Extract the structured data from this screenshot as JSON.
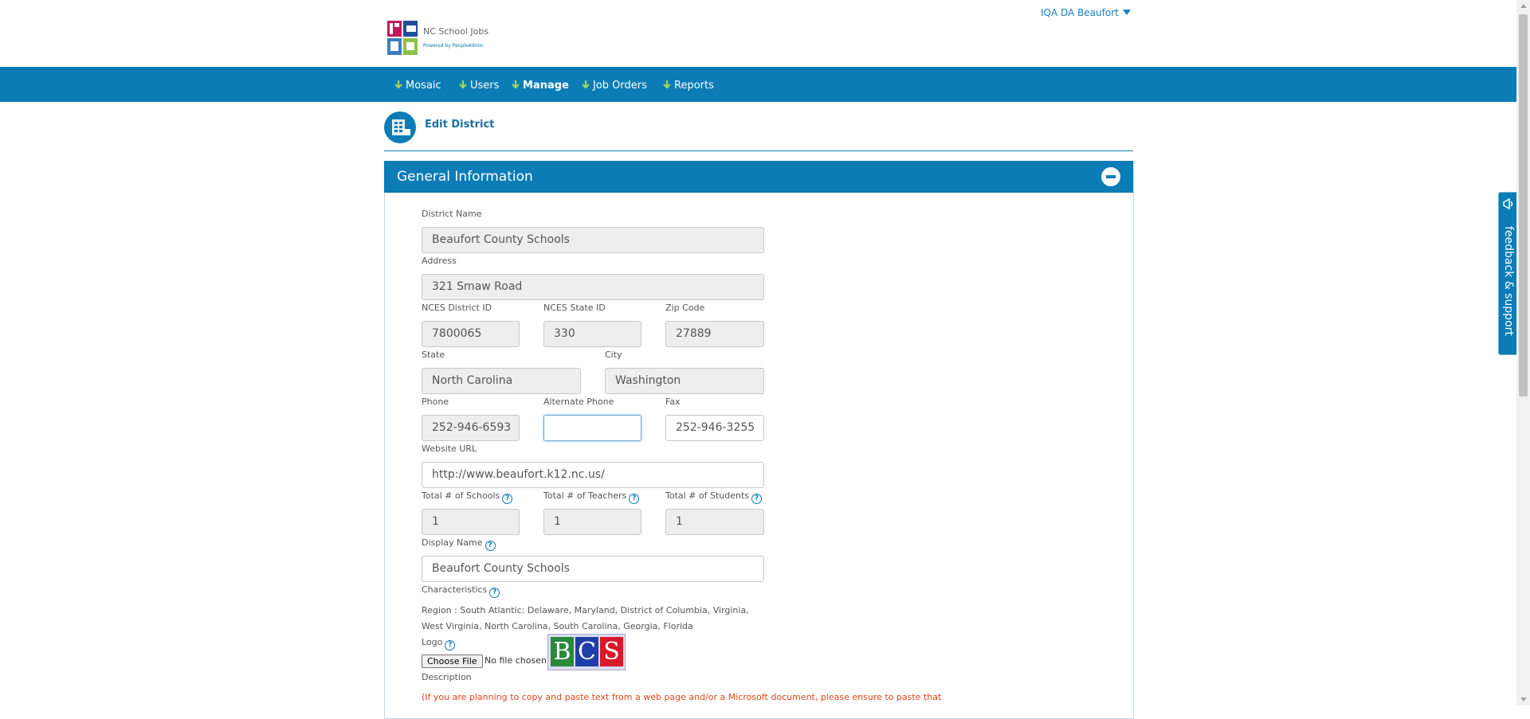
{
  "header": {
    "logo_title": "NC School Jobs",
    "logo_sub": "Powered by PeopleAdmin",
    "user_menu": "IQA DA Beaufort"
  },
  "nav": [
    {
      "label": "Mosaic",
      "bold": false
    },
    {
      "label": "Users",
      "bold": false
    },
    {
      "label": "Manage",
      "bold": true
    },
    {
      "label": "Job Orders",
      "bold": false
    },
    {
      "label": "Reports",
      "bold": false
    }
  ],
  "page": {
    "title": "Edit District"
  },
  "panel": {
    "title": "General Information"
  },
  "form": {
    "district_name": {
      "label": "District Name",
      "value": "Beaufort County Schools"
    },
    "address": {
      "label": "Address",
      "value": "321 Smaw Road"
    },
    "nces_district_id": {
      "label": "NCES District ID",
      "value": "7800065"
    },
    "nces_state_id": {
      "label": "NCES State ID",
      "value": "330"
    },
    "zip": {
      "label": "Zip Code",
      "value": "27889"
    },
    "state": {
      "label": "State",
      "value": "North Carolina"
    },
    "city": {
      "label": "City",
      "value": "Washington"
    },
    "phone": {
      "label": "Phone",
      "value": "252-946-6593"
    },
    "alt_phone": {
      "label": "Alternate Phone",
      "value": ""
    },
    "fax": {
      "label": "Fax",
      "value": "252-946-3255"
    },
    "website": {
      "label": "Website URL",
      "value": "http://www.beaufort.k12.nc.us/"
    },
    "total_schools": {
      "label": "Total # of Schools",
      "value": "1"
    },
    "total_teachers": {
      "label": "Total # of Teachers",
      "value": "1"
    },
    "total_students": {
      "label": "Total # of Students",
      "value": "1"
    },
    "display_name": {
      "label": "Display Name",
      "value": "Beaufort County Schools"
    },
    "characteristics": {
      "label": "Characteristics",
      "region_text": "Region : South Atlantic: Delaware, Maryland, District of Columbia, Virginia, West Virginia, North Carolina, South Carolina, Georgia, Florida"
    },
    "logo": {
      "label": "Logo",
      "choose_label": "Choose File",
      "no_file": "No file chosen",
      "letters": [
        "B",
        "C",
        "S"
      ],
      "letter_colors": [
        "#2a8a3a",
        "#1f3fa8",
        "#d8192a"
      ]
    },
    "description": {
      "label": "Description",
      "warning": "(If you are planning to copy and paste text from a web page and/or a Microsoft document, please ensure to paste that"
    }
  },
  "help_glyph": "?",
  "feedback": {
    "label": "feedback & support"
  },
  "colors": {
    "brand": "#0b7cb5",
    "warning": "#e0461c"
  }
}
